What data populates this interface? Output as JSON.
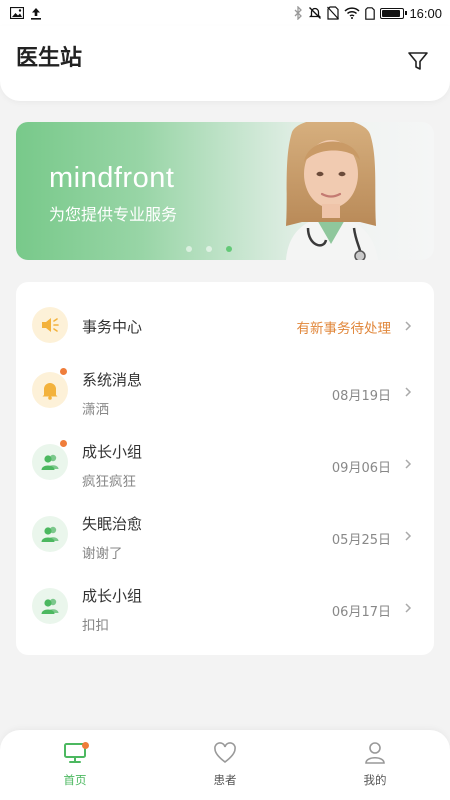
{
  "status_bar": {
    "time": "16:00",
    "left_icons": [
      "image-icon",
      "upload-icon"
    ],
    "right_icons": [
      "bluetooth-icon",
      "mute-icon",
      "no-sim-icon",
      "wifi-icon",
      "sim-icon",
      "battery-icon"
    ]
  },
  "header": {
    "title": "医生站",
    "filter_icon": "filter-icon"
  },
  "banner": {
    "title": "mindfront",
    "subtitle": "为您提供专业服务",
    "dots": 3,
    "active_dot": 2
  },
  "list": [
    {
      "title": "事务中心",
      "subtitle": "",
      "meta": "有新事务待处理",
      "icon": "speaker-icon",
      "badge": false,
      "alert": true
    },
    {
      "title": "系统消息",
      "subtitle": "潇洒",
      "meta": "08月19日",
      "icon": "bell-icon",
      "badge": true,
      "alert": false
    },
    {
      "title": "成长小组",
      "subtitle": "疯狂疯狂",
      "meta": "09月06日",
      "icon": "group-icon",
      "badge": true,
      "alert": false
    },
    {
      "title": "失眠治愈",
      "subtitle": "谢谢了",
      "meta": "05月25日",
      "icon": "group-icon",
      "badge": false,
      "alert": false
    },
    {
      "title": "成长小组",
      "subtitle": "扣扣",
      "meta": "06月17日",
      "icon": "group-icon",
      "badge": false,
      "alert": false
    }
  ],
  "bottom_nav": [
    {
      "label": "首页",
      "icon": "monitor-icon",
      "active": true,
      "badge": true
    },
    {
      "label": "患者",
      "icon": "heart-icon",
      "active": false,
      "badge": false
    },
    {
      "label": "我的",
      "icon": "user-icon",
      "active": false,
      "badge": false
    }
  ],
  "colors": {
    "accent_green": "#4cb860",
    "alert_orange": "#e1873b",
    "badge_orange": "#ef7d3a",
    "yellow_bg": "#fdf1d8",
    "green_bg": "#eaf6ec"
  }
}
